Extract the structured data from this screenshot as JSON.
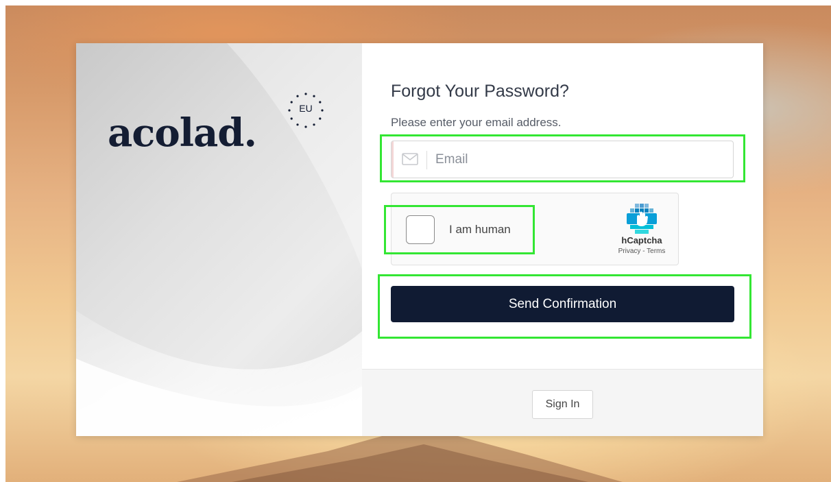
{
  "brand": {
    "logo_text": "acolad.",
    "badge_text": "EU"
  },
  "form": {
    "title": "Forgot Your Password?",
    "subtitle": "Please enter your email address.",
    "email_placeholder": "Email",
    "email_value": "",
    "submit_label": "Send Confirmation"
  },
  "captcha": {
    "checkbox_label": "I am human",
    "brand": "hCaptcha",
    "links": "Privacy - Terms",
    "checked": false
  },
  "footer": {
    "signin_label": "Sign In"
  },
  "colors": {
    "primary_button": "#101b33",
    "highlight": "#33e633",
    "logo": "#141d33"
  }
}
